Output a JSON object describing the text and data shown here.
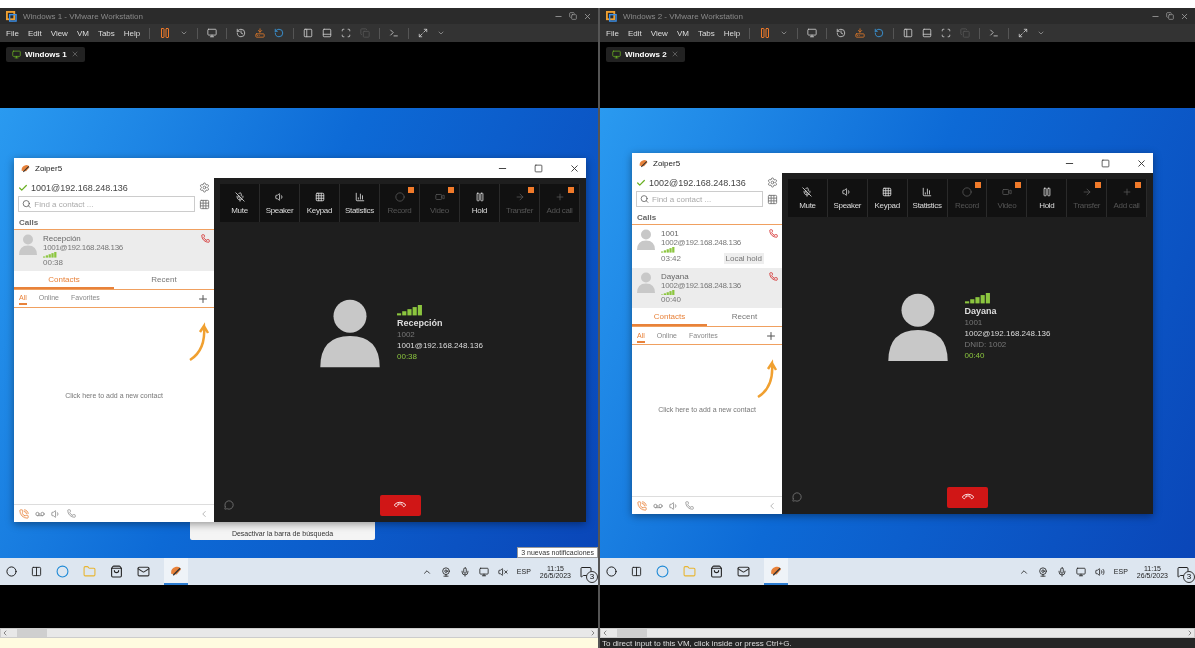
{
  "vms": [
    {
      "title": "Windows 1 - VMware Workstation",
      "menu": [
        "File",
        "Edit",
        "View",
        "VM",
        "Tabs",
        "Help"
      ],
      "tab": "Windows 1",
      "zoiper": {
        "title": "Zoiper5",
        "account": "1001@192.168.248.136",
        "search_placeholder": "Find a contact ...",
        "calls_heading": "Calls",
        "calls": [
          {
            "name": "Recepción",
            "address": "1001@192.168.248.136",
            "duration": "00:38",
            "selected": true
          }
        ],
        "list_tabs": [
          {
            "label": "Contacts",
            "selected": true
          },
          {
            "label": "Recent",
            "selected": false
          }
        ],
        "filters": [
          {
            "label": "All",
            "selected": true
          },
          {
            "label": "Online",
            "selected": false
          },
          {
            "label": "Favorites",
            "selected": false
          }
        ],
        "empty_hint": "Click here to add a new contact",
        "controls": [
          {
            "label": "Mute",
            "disabled": false
          },
          {
            "label": "Speaker",
            "disabled": false
          },
          {
            "label": "Keypad",
            "disabled": false
          },
          {
            "label": "Statistics",
            "disabled": false
          },
          {
            "label": "Record",
            "disabled": true
          },
          {
            "label": "Video",
            "disabled": true
          },
          {
            "label": "Hold",
            "disabled": false
          },
          {
            "label": "Transfer",
            "disabled": true
          },
          {
            "label": "Add call",
            "disabled": true
          }
        ],
        "caller": {
          "name": "Recepción",
          "details": [
            {
              "text": "1002",
              "kind": "muted"
            },
            {
              "text": "1001@192.168.248.136",
              "kind": "plain"
            },
            {
              "text": "00:38",
              "kind": "timer"
            }
          ]
        }
      },
      "popup": "Desactivar la barra de búsqueda",
      "tooltip": "3 nuevas notificaciones",
      "tray": {
        "muted": true,
        "language": "ESP",
        "time": "11:15",
        "date": "26/5/2023",
        "notifications": "3"
      },
      "status_bar": {
        "kind": "notice"
      }
    },
    {
      "title": "Windows 2 - VMware Workstation",
      "menu": [
        "File",
        "Edit",
        "View",
        "VM",
        "Tabs",
        "Help"
      ],
      "tab": "Windows 2",
      "zoiper": {
        "title": "Zoiper5",
        "account": "1002@192.168.248.136",
        "search_placeholder": "Find a contact ...",
        "calls_heading": "Calls",
        "calls": [
          {
            "name": "1001",
            "address": "1002@192.168.248.136",
            "duration": "03:42",
            "selected": false,
            "badge": "Local hold"
          },
          {
            "name": "Dayana",
            "address": "1002@192.168.248.136",
            "duration": "00:40",
            "selected": true
          }
        ],
        "list_tabs": [
          {
            "label": "Contacts",
            "selected": true
          },
          {
            "label": "Recent",
            "selected": false
          }
        ],
        "filters": [
          {
            "label": "All",
            "selected": true
          },
          {
            "label": "Online",
            "selected": false
          },
          {
            "label": "Favorites",
            "selected": false
          }
        ],
        "empty_hint": "Click here to add a new contact",
        "controls": [
          {
            "label": "Mute",
            "disabled": false
          },
          {
            "label": "Speaker",
            "disabled": false
          },
          {
            "label": "Keypad",
            "disabled": false
          },
          {
            "label": "Statistics",
            "disabled": false
          },
          {
            "label": "Record",
            "disabled": true
          },
          {
            "label": "Video",
            "disabled": true
          },
          {
            "label": "Hold",
            "disabled": false
          },
          {
            "label": "Transfer",
            "disabled": true
          },
          {
            "label": "Add call",
            "disabled": true
          }
        ],
        "caller": {
          "name": "Dayana",
          "details": [
            {
              "text": "1001",
              "kind": "muted"
            },
            {
              "text": "1002@192.168.248.136",
              "kind": "plain"
            },
            {
              "text": "DNID: 1002",
              "kind": "muted"
            },
            {
              "text": "00:40",
              "kind": "timer"
            }
          ]
        }
      },
      "tray": {
        "muted": false,
        "language": "ESP",
        "time": "11:15",
        "date": "26/5/2023",
        "notifications": "3"
      },
      "status_bar": {
        "kind": "message",
        "text": "To direct input to this VM, click inside or press Ctrl+G."
      }
    }
  ]
}
